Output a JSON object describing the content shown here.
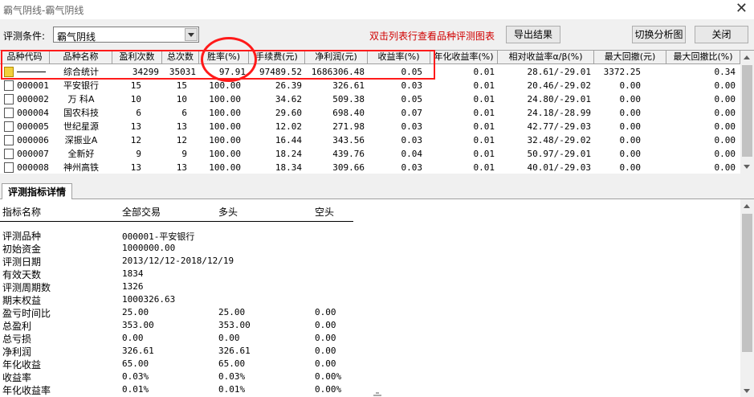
{
  "window": {
    "title": "霸气阴线-霸气阴线",
    "close_glyph": "✕"
  },
  "toolbar": {
    "condition_label": "评测条件:",
    "condition_value": "霸气阴线",
    "hint": "双击列表行查看品种评测图表",
    "export_label": "导出结果",
    "switch_label": "切换分析图",
    "close_label": "关闭"
  },
  "grid": {
    "columns": [
      "品种代码",
      "品种名称",
      "盈利次数",
      "总次数",
      "胜率(%)",
      "手续费(元)",
      "净利润(元)",
      "收益率(%)",
      "年化收益率(%)",
      "相对收益率α/β(%)",
      "最大回撤(元)",
      "最大回撤比(%)"
    ],
    "summary": {
      "code": "",
      "name": "综合统计",
      "wins": "34299",
      "total": "35031",
      "win_rate": "97.91",
      "fee": "97489.52",
      "net_profit": "1686306.48",
      "return_rate": "0.05",
      "annual_return": "0.01",
      "relative_return": "28.61/-29.01",
      "max_drawdown": "3372.25",
      "max_drawdown_ratio": "0.34"
    },
    "rows": [
      {
        "code": "000001",
        "name": "平安银行",
        "wins": "15",
        "total": "15",
        "win_rate": "100.00",
        "fee": "26.39",
        "net_profit": "326.61",
        "return_rate": "0.03",
        "annual_return": "0.01",
        "relative_return": "20.46/-29.02",
        "max_drawdown": "0.00",
        "max_drawdown_ratio": "0.00"
      },
      {
        "code": "000002",
        "name": "万 科A",
        "wins": "10",
        "total": "10",
        "win_rate": "100.00",
        "fee": "34.62",
        "net_profit": "509.38",
        "return_rate": "0.05",
        "annual_return": "0.01",
        "relative_return": "24.80/-29.01",
        "max_drawdown": "0.00",
        "max_drawdown_ratio": "0.00"
      },
      {
        "code": "000004",
        "name": "国农科技",
        "wins": "6",
        "total": "6",
        "win_rate": "100.00",
        "fee": "29.60",
        "net_profit": "698.40",
        "return_rate": "0.07",
        "annual_return": "0.01",
        "relative_return": "24.18/-28.99",
        "max_drawdown": "0.00",
        "max_drawdown_ratio": "0.00"
      },
      {
        "code": "000005",
        "name": "世纪星源",
        "wins": "13",
        "total": "13",
        "win_rate": "100.00",
        "fee": "12.02",
        "net_profit": "271.98",
        "return_rate": "0.03",
        "annual_return": "0.01",
        "relative_return": "42.77/-29.03",
        "max_drawdown": "0.00",
        "max_drawdown_ratio": "0.00"
      },
      {
        "code": "000006",
        "name": "深振业A",
        "wins": "12",
        "total": "12",
        "win_rate": "100.00",
        "fee": "16.44",
        "net_profit": "343.56",
        "return_rate": "0.03",
        "annual_return": "0.01",
        "relative_return": "32.48/-29.02",
        "max_drawdown": "0.00",
        "max_drawdown_ratio": "0.00"
      },
      {
        "code": "000007",
        "name": "全新好",
        "wins": "9",
        "total": "9",
        "win_rate": "100.00",
        "fee": "18.24",
        "net_profit": "439.76",
        "return_rate": "0.04",
        "annual_return": "0.01",
        "relative_return": "50.97/-29.01",
        "max_drawdown": "0.00",
        "max_drawdown_ratio": "0.00"
      },
      {
        "code": "000008",
        "name": "神州高铁",
        "wins": "13",
        "total": "13",
        "win_rate": "100.00",
        "fee": "18.34",
        "net_profit": "309.66",
        "return_rate": "0.03",
        "annual_return": "0.01",
        "relative_return": "40.01/-29.03",
        "max_drawdown": "0.00",
        "max_drawdown_ratio": "0.00"
      }
    ]
  },
  "detail": {
    "tab_label": "评测指标详情",
    "headers": [
      "指标名称",
      "全部交易",
      "多头",
      "空头"
    ],
    "rows": [
      {
        "label": "评测品种",
        "all": "000001-平安银行",
        "long": "",
        "short": ""
      },
      {
        "label": "初始资金",
        "all": "1000000.00",
        "long": "",
        "short": ""
      },
      {
        "label": "评测日期",
        "all": "2013/12/12-2018/12/19",
        "long": "",
        "short": ""
      },
      {
        "label": "有效天数",
        "all": "1834",
        "long": "",
        "short": ""
      },
      {
        "label": "评测周期数",
        "all": "1326",
        "long": "",
        "short": ""
      },
      {
        "label": "期末权益",
        "all": "1000326.63",
        "long": "",
        "short": ""
      },
      {
        "label": "盈亏时间比",
        "all": "25.00",
        "long": "25.00",
        "short": "0.00"
      },
      {
        "label": "总盈利",
        "all": "353.00",
        "long": "353.00",
        "short": "0.00"
      },
      {
        "label": "总亏损",
        "all": "0.00",
        "long": "0.00",
        "short": "0.00"
      },
      {
        "label": "净利润",
        "all": "326.61",
        "long": "326.61",
        "short": "0.00"
      },
      {
        "label": "年化收益",
        "all": "65.00",
        "long": "65.00",
        "short": "0.00"
      },
      {
        "label": "收益率",
        "all": "0.03%",
        "long": "0.03%",
        "short": "0.00%"
      },
      {
        "label": "年化收益率",
        "all": "0.01%",
        "long": "0.01%",
        "short": "0.00%"
      }
    ]
  },
  "colors": {
    "hint": "#d00000",
    "annotation": "#ff1a1a"
  }
}
